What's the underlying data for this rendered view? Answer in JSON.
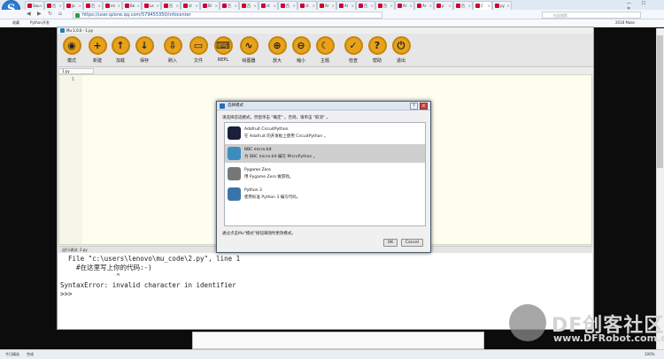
{
  "browser": {
    "tabs": [
      "Sau",
      "百",
      "Ja",
      "百",
      "mi",
      "Be",
      "Le",
      "百",
      "ct",
      "Bl",
      "百",
      "百",
      "ct",
      "百",
      "ct",
      "Ar",
      "Ar",
      "百",
      "百",
      "Ar",
      "Ar",
      "p",
      "百",
      "C",
      "py"
    ],
    "url": "https://user.qzone.qq.com/579455350/infocenter",
    "search_placeholder": "在此搜索",
    "bookmarks": [
      "收藏",
      "Python开发",
      "2018 Make"
    ],
    "window_controls": "— ☐ ✕"
  },
  "mu": {
    "title": "Mu 1.0.0 - 1.py",
    "toolbar": [
      {
        "icon": "mode-icon",
        "glyph": "◉",
        "label": "模式"
      },
      {
        "icon": "new-icon",
        "glyph": "+",
        "label": "新建"
      },
      {
        "icon": "load-icon",
        "glyph": "↑",
        "label": "加载"
      },
      {
        "icon": "save-icon",
        "glyph": "↓",
        "label": "保存"
      },
      {
        "icon": "flash-icon",
        "glyph": "⇩",
        "label": "刷入"
      },
      {
        "icon": "files-icon",
        "glyph": "▭",
        "label": "文件"
      },
      {
        "icon": "repl-icon",
        "glyph": "⌨",
        "label": "REPL"
      },
      {
        "icon": "plotter-icon",
        "glyph": "∿",
        "label": "绘图器"
      },
      {
        "icon": "zoom-in-icon",
        "glyph": "⊕",
        "label": "放大"
      },
      {
        "icon": "zoom-out-icon",
        "glyph": "⊖",
        "label": "缩小"
      },
      {
        "icon": "theme-icon",
        "glyph": "☾",
        "label": "主题"
      },
      {
        "icon": "check-icon",
        "glyph": "✓",
        "label": "检查"
      },
      {
        "icon": "help-icon",
        "glyph": "?",
        "label": "帮助"
      },
      {
        "icon": "quit-icon",
        "glyph": "⏻",
        "label": "退出"
      }
    ],
    "file_tab": "1.py",
    "line_number": "1",
    "repl_header": "运行/调试: 2.py",
    "repl_lines": [
      "  File \"c:\\users\\lenovo\\mu_code\\2.py\", line 1",
      "    #在这里写上你的代码:-)",
      "              ^",
      "SyntaxError: invalid character in identifier",
      ">>> "
    ]
  },
  "dialog": {
    "title": "选择模式",
    "instructions": "请选择首选模式，然后单击 \"确定\" 。否则，请单击 \"取消\" 。",
    "modes": [
      {
        "name": "Adafruit CircuitPython",
        "desc": "在 Adafruit 的开发板上使用 CircuitPython 。",
        "color": "#1b1f3a"
      },
      {
        "name": "BBC micro:bit",
        "desc": "为 BBC micro:bit 编写 MicroPython 。",
        "color": "#3c8dbd"
      },
      {
        "name": "Pygame Zero",
        "desc": "用 Pygame Zero 做游戏。",
        "color": "#777777"
      },
      {
        "name": "Python 3",
        "desc": "使用标准 Python 3 编写代码。",
        "color": "#3a75a8"
      }
    ],
    "selected_index": 1,
    "hint": "通过点击Mu\"模式\"按钮来随时更改模式。",
    "ok_label": "OK",
    "cancel_label": "Cancel"
  },
  "taskbar": {
    "left": "今日精选",
    "middle": "完成",
    "zoom": "100%"
  },
  "watermark": {
    "brand": "DF创客社区",
    "url": "www.DFRobot.com.cn"
  }
}
